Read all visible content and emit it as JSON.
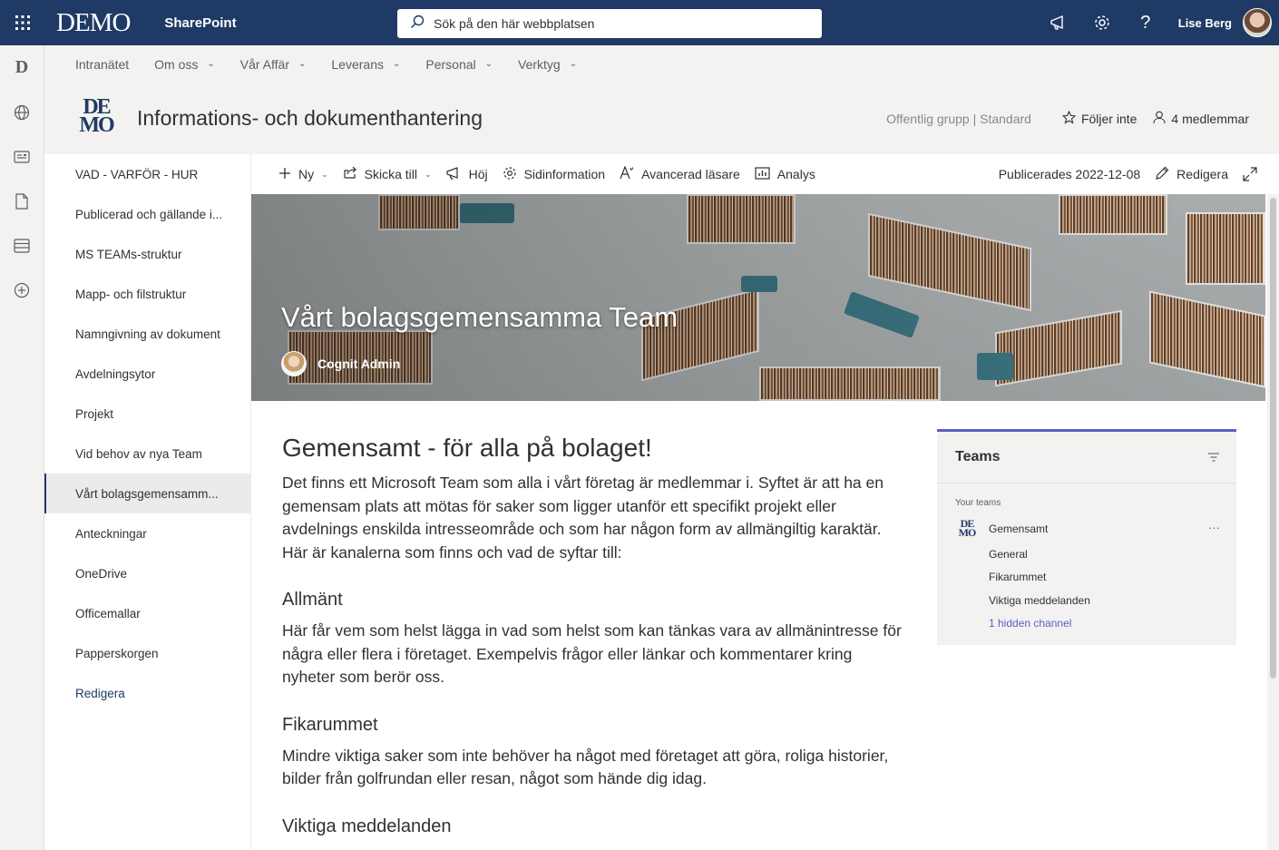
{
  "suite": {
    "brand": "DEMO",
    "app_name": "SharePoint",
    "search_placeholder": "Sök på den här webbplatsen",
    "user_name": "Lise Berg"
  },
  "hub_nav": [
    {
      "label": "Intranätet",
      "has_menu": false
    },
    {
      "label": "Om oss",
      "has_menu": true
    },
    {
      "label": "Vår Affär",
      "has_menu": true
    },
    {
      "label": "Leverans",
      "has_menu": true
    },
    {
      "label": "Personal",
      "has_menu": true
    },
    {
      "label": "Verktyg",
      "has_menu": true
    }
  ],
  "site": {
    "logo_line1": "DE",
    "logo_line2": "MO",
    "title": "Informations- och dokumenthantering",
    "privacy": "Offentlig grupp | Standard",
    "follow_label": "Följer inte",
    "members_label": "4 medlemmar"
  },
  "left_nav": [
    "VAD - VARFÖR - HUR",
    "Publicerad och gällande i...",
    "MS TEAMs-struktur",
    "Mapp- och filstruktur",
    "Namngivning av dokument",
    "Avdelningsytor",
    "Projekt",
    "Vid behov av nya Team",
    "Vårt bolagsgemensamm...",
    "Anteckningar",
    "OneDrive",
    "Officemallar",
    "Papperskorgen",
    "Redigera"
  ],
  "left_nav_active_index": 8,
  "command_bar": {
    "new": "Ny",
    "send": "Skicka till",
    "promote": "Höj",
    "page_details": "Sidinformation",
    "immersive_reader": "Avancerad läsare",
    "analytics": "Analys",
    "published": "Publicerades 2022-12-08",
    "edit": "Redigera"
  },
  "hero": {
    "title": "Vårt bolagsgemensamma Team",
    "author": "Cognit Admin"
  },
  "article": {
    "heading": "Gemensamt - för alla på bolaget!",
    "intro": "Det finns ett Microsoft Team som alla i vårt företag är medlemmar i. Syftet är att ha en gemensam plats att mötas för saker som ligger utanför ett specifikt projekt eller avdelnings enskilda intresseområde och som har någon form av allmängiltig karaktär. Här är kanalerna som finns och vad de syftar till:",
    "section1_title": "Allmänt",
    "section1_text": "Här får vem som helst lägga in vad som helst som kan tänkas vara av allmänintresse för några eller flera i företaget. Exempelvis frågor eller länkar och kommentarer kring nyheter som berör oss.",
    "section2_title": "Fikarummet",
    "section2_text": "Mindre viktiga saker som inte behöver ha något med företaget att göra, roliga historier, bilder från golfrundan eller resan, något som hände dig idag.",
    "section3_title": "Viktiga meddelanden"
  },
  "teams_panel": {
    "title": "Teams",
    "your_teams": "Your teams",
    "team_logo_line1": "DE",
    "team_logo_line2": "MO",
    "team_name": "Gemensamt",
    "more": "···",
    "channels": [
      "General",
      "Fikarummet",
      "Viktiga meddelanden"
    ],
    "hidden_channel": "1 hidden channel"
  },
  "colors": {
    "suite_bar": "#1f3a64",
    "teams_accent": "#5b5fc7",
    "nav_background": "#f3f2f1"
  }
}
